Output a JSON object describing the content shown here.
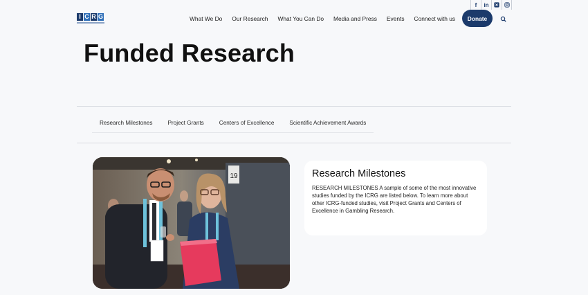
{
  "social": {
    "facebook": "f",
    "linkedin": "in",
    "x": "X",
    "instagram": "ig"
  },
  "logo": {
    "letters": [
      "I",
      "C",
      "R",
      "G"
    ],
    "colors": [
      "#1b3a6b",
      "#2f6fb8",
      "#1b3a6b",
      "#2f6fb8"
    ]
  },
  "nav": {
    "items": [
      "What We Do",
      "Our Research",
      "What You Can Do",
      "Media and Press",
      "Events",
      "Connect with us"
    ],
    "donate_label": "Donate"
  },
  "page": {
    "title": "Funded Research"
  },
  "subnav": {
    "items": [
      "Research Milestones",
      "Project Grants",
      "Centers of Excellence",
      "Scientific Achievement Awards"
    ]
  },
  "card": {
    "title": "Research Milestones",
    "body": "RESEARCH MILESTONES A sample of some of the most innovative studies funded by the ICRG are listed below. To learn more about other ICRG-funded studies, visit Project Grants and Centers of Excellence in Gambling Research."
  },
  "photo": {
    "sign_number": "19"
  },
  "colors": {
    "brand": "#1b3a6b",
    "background": "#f7f8fa"
  }
}
